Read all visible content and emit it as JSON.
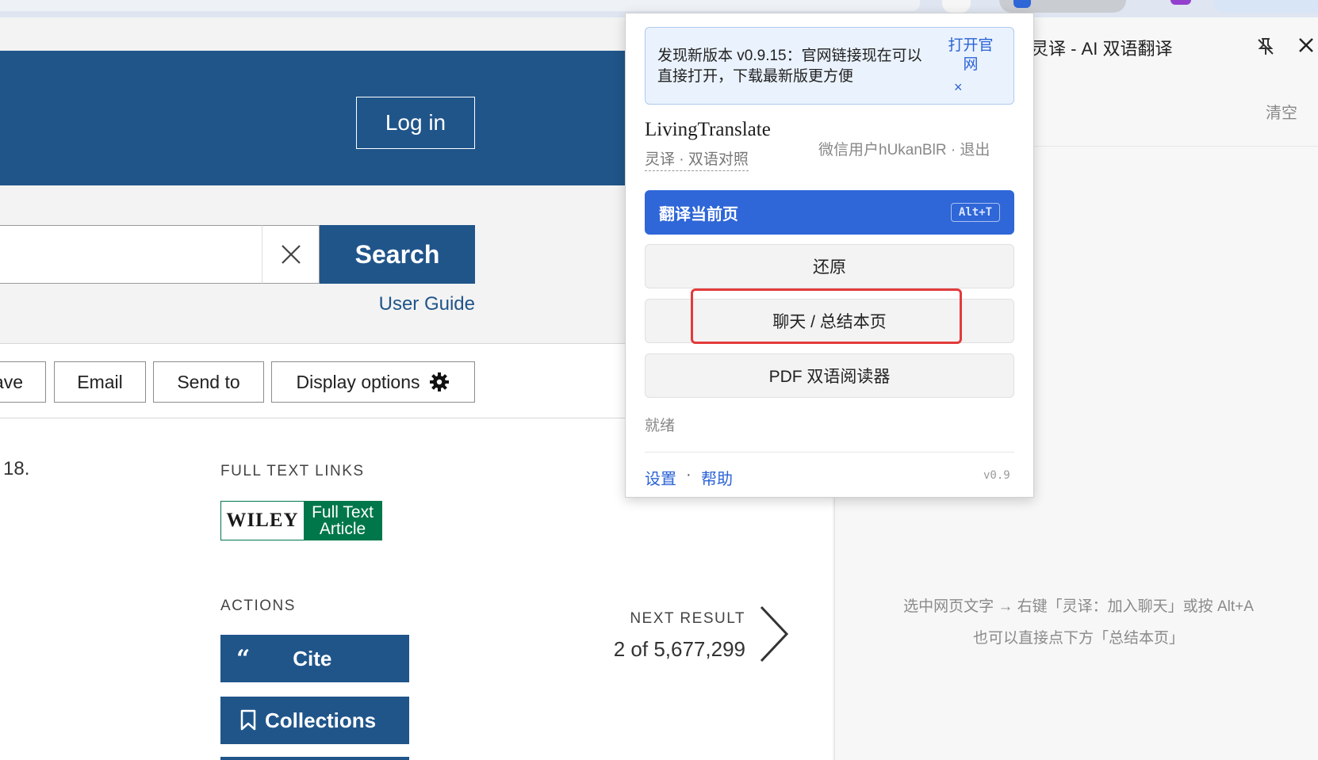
{
  "header": {
    "login_label": "Log in"
  },
  "search": {
    "button_label": "Search",
    "user_guide": "User Guide"
  },
  "toolbar": {
    "save_partial": "ave",
    "email": "Email",
    "send_to": "Send to",
    "display_options": "Display options"
  },
  "article": {
    "year_partial": "18.",
    "full_text_links_label": "FULL TEXT LINKS",
    "wiley": {
      "brand": "WILEY",
      "line1": "Full Text",
      "line2": "Article"
    },
    "actions_label": "ACTIONS",
    "cite_label": "Cite",
    "collections_label": "Collections",
    "next_result_label": "NEXT RESULT",
    "next_result_count": "2 of 5,677,299"
  },
  "popup": {
    "update_text": "发现新版本 v0.9.15：官网链接现在可以直接打开，下载最新版更方便",
    "update_open": "打开官网",
    "update_close": "×",
    "brand_name": "LivingTranslate",
    "brand_sub": "灵译 · 双语对照",
    "user_info": "微信用户hUkanBlR · 退出",
    "translate_label": "翻译当前页",
    "translate_shortcut": "Alt+T",
    "restore_label": "还原",
    "chat_label": "聊天 / 总结本页",
    "pdf_label": "PDF 双语阅读器",
    "status": "就绪",
    "settings": "设置",
    "dot": "·",
    "help": "帮助",
    "version": "v0.9"
  },
  "side_panel": {
    "title": "灵译 - AI 双语翻译",
    "clear": "清空",
    "hint_line1": "选中网页文字 → 右键「灵译：加入聊天」或按 Alt+A",
    "hint_line2": "也可以直接点下方「总结本页」"
  },
  "colors": {
    "pubmed_blue": "#20558a",
    "wiley_green": "#00774a",
    "extension_blue": "#2f66d8",
    "highlight_red": "#e23b3b"
  },
  "icons": [
    "close-x-icon",
    "gear-icon",
    "quote-icon",
    "bookmark-icon",
    "chevron-right-icon",
    "pin-icon",
    "close-icon"
  ]
}
